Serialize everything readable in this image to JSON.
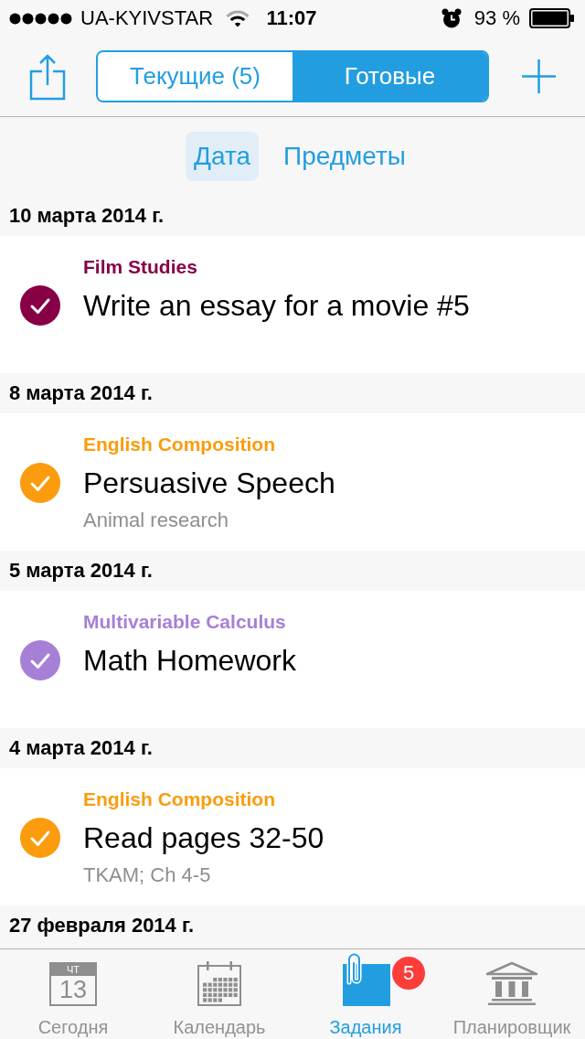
{
  "status_bar": {
    "carrier": "UA-KYIVSTAR",
    "time": "11:07",
    "battery": "93 %"
  },
  "nav_bar": {
    "segments": [
      {
        "label": "Текущие (5)",
        "selected": false
      },
      {
        "label": "Готовые",
        "selected": true
      }
    ]
  },
  "sort_tabs": [
    {
      "label": "Дата",
      "selected": true
    },
    {
      "label": "Предметы",
      "selected": false
    }
  ],
  "sections": [
    {
      "date": "10 марта 2014 г.",
      "tasks": [
        {
          "subject": "Film Studies",
          "color": "#870046",
          "title": "Write an essay for a movie #5",
          "checked": true
        }
      ]
    },
    {
      "date": "8 марта 2014 г.",
      "tasks": [
        {
          "subject": "English Composition",
          "color": "#fa9c0d",
          "title": "Persuasive Speech",
          "note": "Animal research",
          "checked": true
        }
      ]
    },
    {
      "date": "5 марта 2014 г.",
      "tasks": [
        {
          "subject": "Multivariable Calculus",
          "color": "#a680d7",
          "title": "Math Homework",
          "checked": true
        }
      ]
    },
    {
      "date": "4 марта 2014 г.",
      "tasks": [
        {
          "subject": "English Composition",
          "color": "#fa9c0d",
          "title": "Read pages 32-50",
          "note": "TKAM; Ch 4-5",
          "checked": true
        }
      ]
    },
    {
      "date": "27 февраля 2014 г."
    }
  ],
  "tab_bar": [
    {
      "kind": "today",
      "label": "Сегодня",
      "weekday": "ЧТ",
      "day": "13",
      "selected": false
    },
    {
      "kind": "calendar",
      "label": "Календарь",
      "selected": false
    },
    {
      "kind": "tasks",
      "label": "Задания",
      "badge": "5",
      "selected": true
    },
    {
      "kind": "planner",
      "label": "Планировщик",
      "selected": false
    }
  ]
}
